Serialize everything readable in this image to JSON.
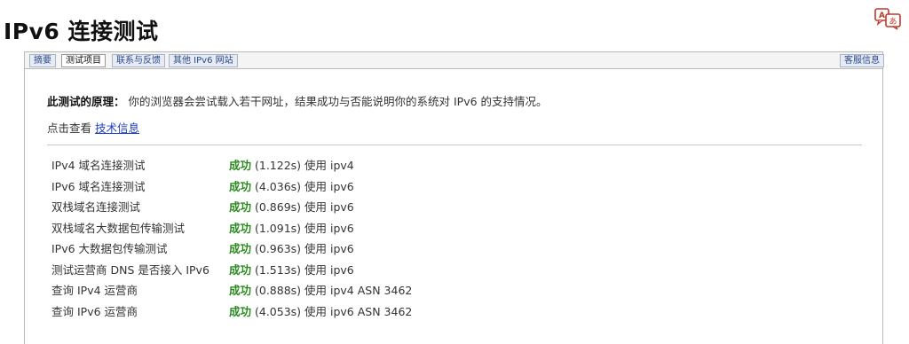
{
  "page": {
    "title": "IPv6 连接测试"
  },
  "tabs": [
    {
      "label": "摘要"
    },
    {
      "label": "测试项目",
      "active": true
    },
    {
      "label": "联系与反馈"
    },
    {
      "label": "其他 IPv6 网站"
    },
    {
      "label": "客服信息"
    }
  ],
  "intro": {
    "label": "此测试的原理：",
    "text": "你的浏览器会尝试载入若干网址，结果成功与否能说明你的系统对 IPv6 的支持情况。"
  },
  "more": {
    "prefix": "点击查看",
    "link": "技术信息"
  },
  "results": [
    {
      "name": "IPv4 域名连接测试",
      "status": "成功",
      "detail": "(1.122s) 使用 ipv4"
    },
    {
      "name": "IPv6 域名连接测试",
      "status": "成功",
      "detail": "(4.036s) 使用 ipv6"
    },
    {
      "name": "双栈域名连接测试",
      "status": "成功",
      "detail": "(0.869s) 使用 ipv6"
    },
    {
      "name": "双栈域名大数据包传输测试",
      "status": "成功",
      "detail": "(1.091s) 使用 ipv6"
    },
    {
      "name": "IPv6 大数据包传输测试",
      "status": "成功",
      "detail": "(0.963s) 使用 ipv6"
    },
    {
      "name": "测试运营商 DNS 是否接入 IPv6",
      "status": "成功",
      "detail": "(1.513s) 使用 ipv6"
    },
    {
      "name": "查询 IPv4 运营商",
      "status": "成功",
      "detail": "(0.888s) 使用 ipv4 ASN 3462"
    },
    {
      "name": "查询 IPv6 运营商",
      "status": "成功",
      "detail": "(4.053s) 使用 ipv6 ASN 3462"
    }
  ],
  "colors": {
    "success": "#2a8a1e",
    "link": "#1a3ec8",
    "tab_bg": "#e7ebf4"
  },
  "icons": {
    "translate": "translate-icon"
  }
}
